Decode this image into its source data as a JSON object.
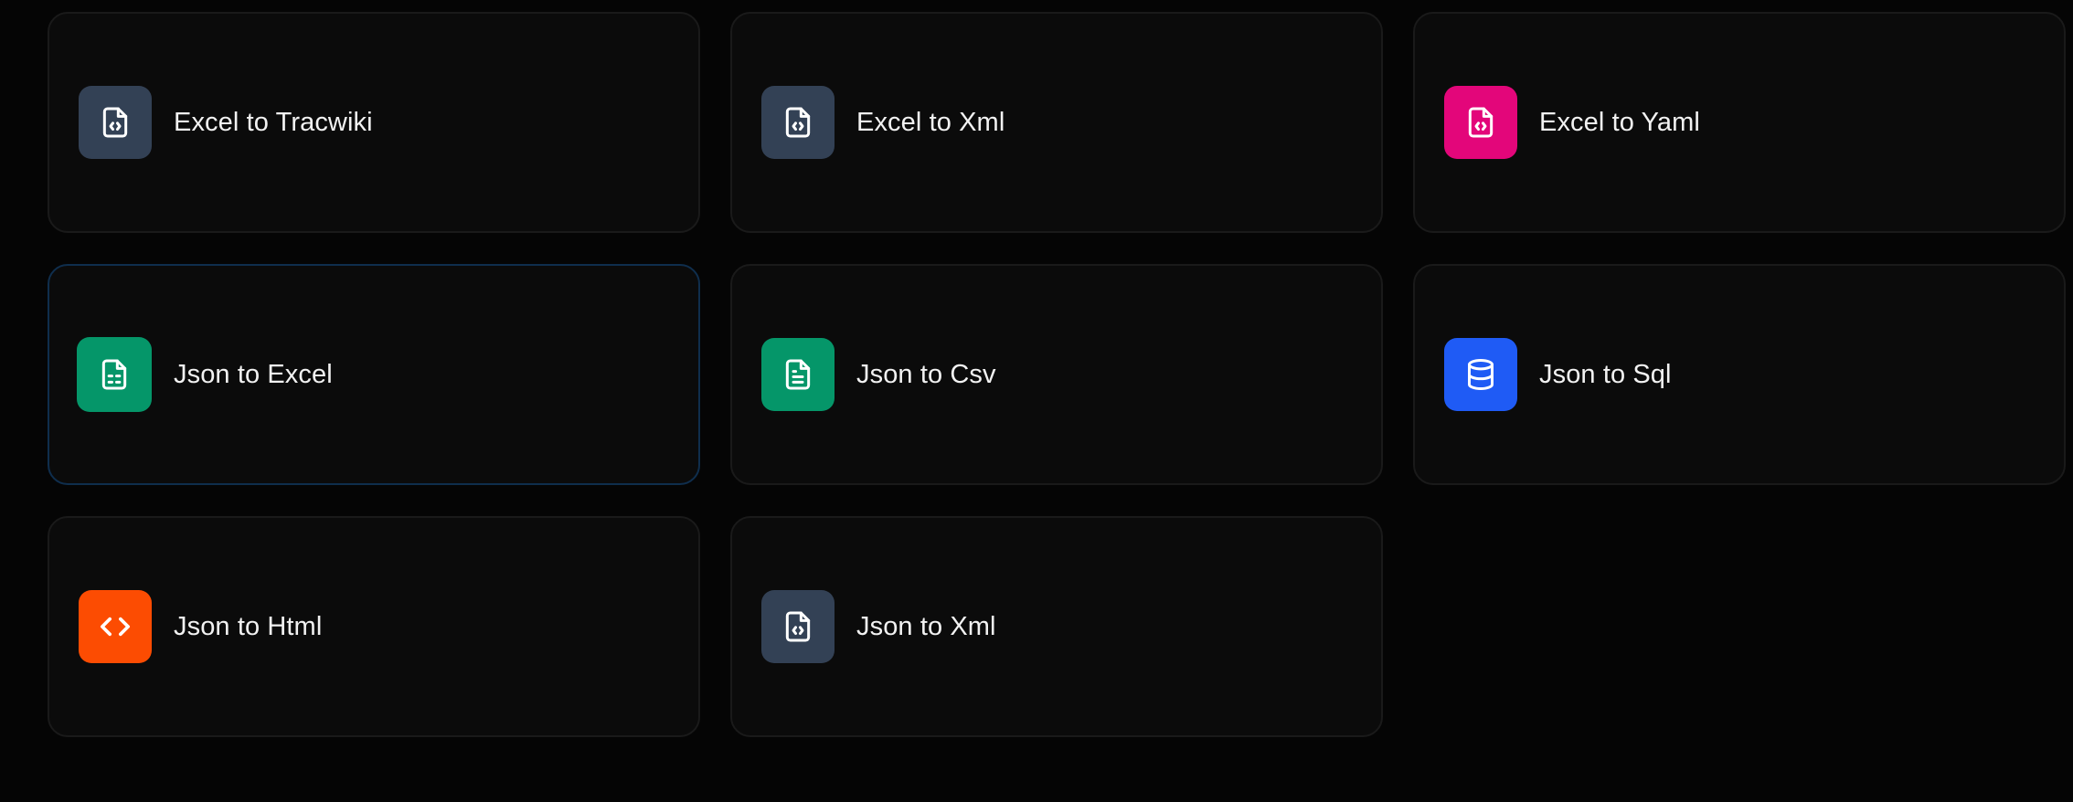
{
  "cards": [
    {
      "label": "Excel to Tracwiki",
      "icon": "file-code-icon",
      "color": "#334155"
    },
    {
      "label": "Excel to Xml",
      "icon": "file-code-icon",
      "color": "#334155"
    },
    {
      "label": "Excel to Yaml",
      "icon": "file-code-icon",
      "color": "#e3067a"
    },
    {
      "label": "Json to Excel",
      "icon": "file-spreadsheet-icon",
      "color": "#059669"
    },
    {
      "label": "Json to Csv",
      "icon": "file-text-icon",
      "color": "#059669"
    },
    {
      "label": "Json to Sql",
      "icon": "database-icon",
      "color": "#1f5bf5"
    },
    {
      "label": "Json to Html",
      "icon": "code-icon",
      "color": "#fc4c02"
    },
    {
      "label": "Json to Xml",
      "icon": "file-code-icon",
      "color": "#334155"
    }
  ]
}
